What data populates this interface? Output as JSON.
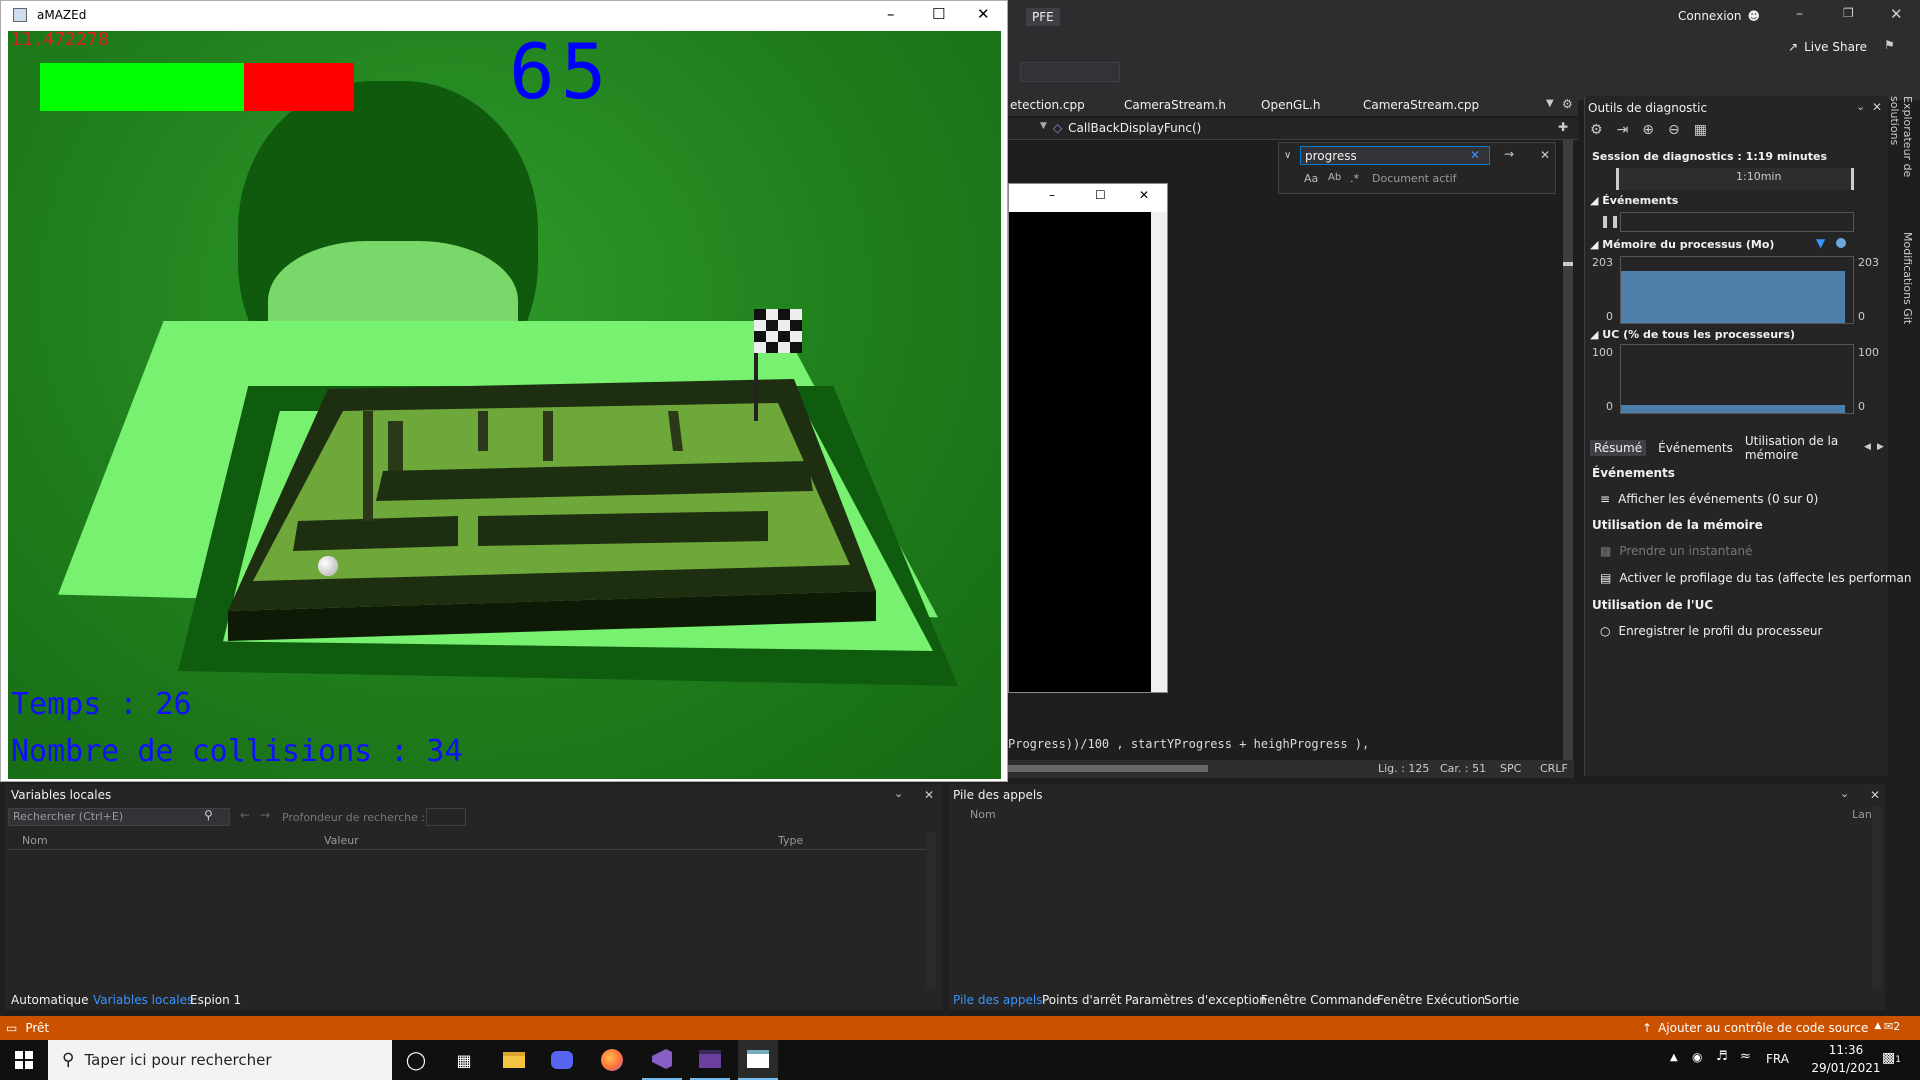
{
  "game": {
    "title": "aMAZEd",
    "fps": "11.472278",
    "score": "65",
    "time_label": "Temps : 26",
    "collisions_label": "Nombre de collisions : 34",
    "progress": 0.65
  },
  "vs": {
    "solution": "PFE",
    "signin": "Connexion",
    "live_share": "Live Share",
    "tabs": [
      "etection.cpp",
      "CameraStream.h",
      "OpenGL.h",
      "CameraStream.cpp"
    ],
    "function_nav": "CallBackDisplayFunc()",
    "search_text": "progress",
    "search_scope": "Document actif",
    "code_line": "Progress))/100 , startYProgress + heighProgress ),",
    "status_line": "Lig. : 125",
    "status_col": "Car. : 51",
    "status_spc": "SPC",
    "status_crlf": "CRLF"
  },
  "diag": {
    "title": "Outils de diagnostic",
    "session": "Session de diagnostics : 1:19 minutes",
    "timeline": "1:10min",
    "events": "Événements",
    "memory": "Mémoire du processus (Mo)",
    "mem_max": "203",
    "mem_min": "0",
    "cpu": "UC (% de tous les processeurs)",
    "cpu_max": "100",
    "cpu_min": "0",
    "tabs": [
      "Résumé",
      "Événements",
      "Utilisation de la mémoire"
    ],
    "sec_events": "Événements",
    "show_events": "Afficher les événements (0 sur 0)",
    "sec_memory": "Utilisation de la mémoire",
    "snapshot": "Prendre un instantané",
    "heap": "Activer le profilage du tas (affecte les performan",
    "sec_cpu": "Utilisation de l'UC",
    "cpu_profile": "Enregistrer le profil du processeur",
    "side1": "Explorateur de solutions",
    "side2": "Modifications Git"
  },
  "locals": {
    "title": "Variables locales",
    "search_placeholder": "Rechercher (Ctrl+E)",
    "depth": "Profondeur de recherche :",
    "col_name": "Nom",
    "col_value": "Valeur",
    "col_type": "Type",
    "tabs": [
      "Automatique",
      "Variables locales",
      "Espion 1"
    ]
  },
  "callstack": {
    "title": "Pile des appels",
    "col_name": "Nom",
    "col_lang": "Lang",
    "tabs": [
      "Pile des appels",
      "Points d'arrêt",
      "Paramètres d'exception",
      "Fenêtre Commande",
      "Fenêtre Exécution",
      "Sortie"
    ]
  },
  "status": {
    "ready": "Prêt",
    "source_control": "Ajouter au contrôle de code source",
    "notif": "2"
  },
  "taskbar": {
    "search": "Taper ici pour rechercher",
    "lang": "FRA",
    "time": "11:36",
    "date": "29/01/2021",
    "notif": "1"
  },
  "colors": {
    "accent": "#007acc",
    "status_bar": "#ca5100",
    "game_green": "#00ff00",
    "game_red": "#ff0000",
    "score_blue": "#0000ff"
  }
}
